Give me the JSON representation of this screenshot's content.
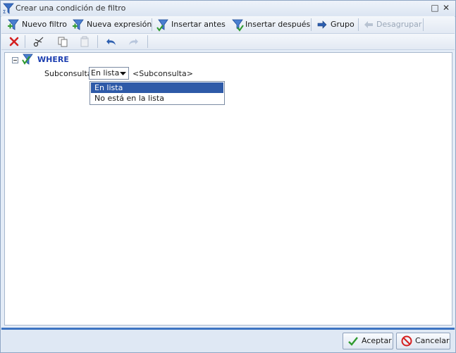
{
  "window": {
    "title": "Crear una condición de filtro"
  },
  "toolbar": {
    "new_filter": "Nuevo filtro",
    "new_expression": "Nueva expresión",
    "insert_before": "Insertar antes",
    "insert_after": "Insertar después",
    "group": "Grupo",
    "ungroup": "Desagrupar"
  },
  "edit_toolbar": {
    "icons": [
      "delete-icon",
      "cut-icon",
      "copy-icon",
      "paste-icon",
      "undo-icon",
      "redo-icon"
    ]
  },
  "tree": {
    "root_label": "WHERE",
    "condition_label": "Subconsulta",
    "operator_value": "En lista",
    "operand_placeholder": "<Subconsulta>"
  },
  "dropdown": {
    "options": [
      "En lista",
      "No está en la lista"
    ],
    "selected_index": 0
  },
  "footer": {
    "accept": "Aceptar",
    "cancel": "Cancelar"
  },
  "colors": {
    "accent": "#2e5aa8",
    "where_label": "#1d3fb0",
    "footer_bar": "#3d74c2"
  }
}
